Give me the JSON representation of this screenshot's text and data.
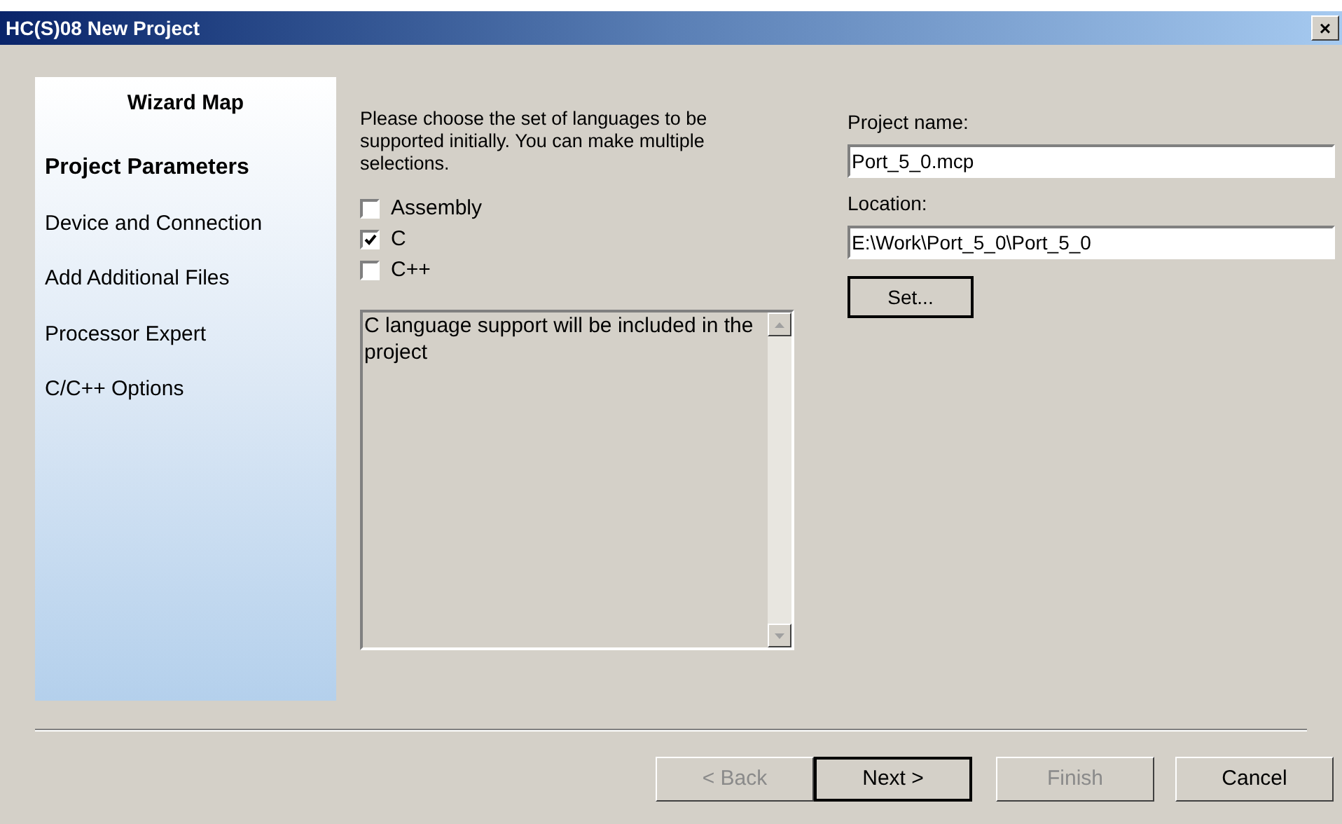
{
  "window": {
    "title": "HC(S)08 New Project",
    "close": "×"
  },
  "wizard_map": {
    "title": "Wizard Map",
    "items": [
      {
        "label": "Project Parameters",
        "selected": true
      },
      {
        "label": "Device and Connection",
        "selected": false
      },
      {
        "label": "Add Additional Files",
        "selected": false
      },
      {
        "label": "Processor Expert",
        "selected": false
      },
      {
        "label": "C/C++ Options",
        "selected": false
      }
    ]
  },
  "instructions": "Please choose the set of languages to be supported initially. You can make multiple selections.",
  "languages": [
    {
      "label": "Assembly",
      "checked": false
    },
    {
      "label": "C",
      "checked": true
    },
    {
      "label": "C++",
      "checked": false
    }
  ],
  "description": "C language support will be included in the project",
  "project_name": {
    "label": "Project name:",
    "value": "Port_5_0.mcp"
  },
  "location": {
    "label": "Location:",
    "value": "E:\\Work\\Port_5_0\\Port_5_0"
  },
  "set_button": "Set...",
  "buttons": [
    {
      "label": "< Back",
      "disabled": true,
      "default": false
    },
    {
      "label": "Next >",
      "disabled": false,
      "default": true
    },
    {
      "label": "Finish",
      "disabled": true,
      "default": false
    },
    {
      "label": "Cancel",
      "disabled": false,
      "default": false
    }
  ]
}
